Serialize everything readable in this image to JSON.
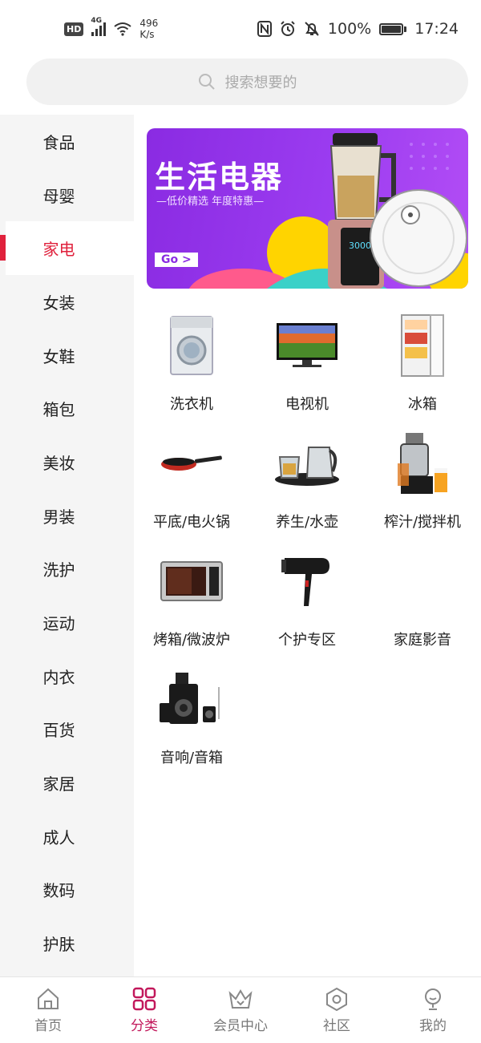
{
  "status_bar": {
    "hd": "HD",
    "signal": "4G",
    "net_speed_value": "496",
    "net_speed_unit": "K/s",
    "battery": "100%",
    "time": "17:24"
  },
  "search": {
    "placeholder": "搜索想要的"
  },
  "sidebar": {
    "items": [
      "食品",
      "母婴",
      "家电",
      "女装",
      "女鞋",
      "箱包",
      "美妆",
      "男装",
      "洗护",
      "运动",
      "内衣",
      "百货",
      "家居",
      "成人",
      "数码",
      "护肤"
    ],
    "active": "家电"
  },
  "banner": {
    "title": "生活电器",
    "subtitle": "低价精选  年度特惠",
    "go": "Go >",
    "display_readout": "3000",
    "colors": {
      "background": "#8a2be2",
      "accent_yellow": "#ffd400",
      "accent_pink": "#ff5a8c"
    }
  },
  "categories": [
    {
      "label": "洗衣机",
      "icon": "washing-machine-icon"
    },
    {
      "label": "电视机",
      "icon": "tv-icon"
    },
    {
      "label": "冰箱",
      "icon": "fridge-icon"
    },
    {
      "label": "平底/电火锅",
      "icon": "frying-pan-icon"
    },
    {
      "label": "养生/水壶",
      "icon": "kettle-icon"
    },
    {
      "label": "榨汁/搅拌机",
      "icon": "juicer-icon"
    },
    {
      "label": "烤箱/微波炉",
      "icon": "microwave-icon"
    },
    {
      "label": "个护专区",
      "icon": "hair-dryer-icon"
    },
    {
      "label": "家庭影音",
      "icon": ""
    },
    {
      "label": "音响/音箱",
      "icon": "speaker-icon"
    }
  ],
  "bottom_nav": [
    {
      "label": "首页",
      "icon": "home-icon"
    },
    {
      "label": "分类",
      "icon": "category-grid-icon",
      "active": true
    },
    {
      "label": "会员中心",
      "icon": "crown-icon"
    },
    {
      "label": "社区",
      "icon": "hexagon-icon"
    },
    {
      "label": "我的",
      "icon": "user-icon"
    }
  ],
  "colors": {
    "accent": "#e0213c",
    "nav_active": "#c2185b"
  }
}
